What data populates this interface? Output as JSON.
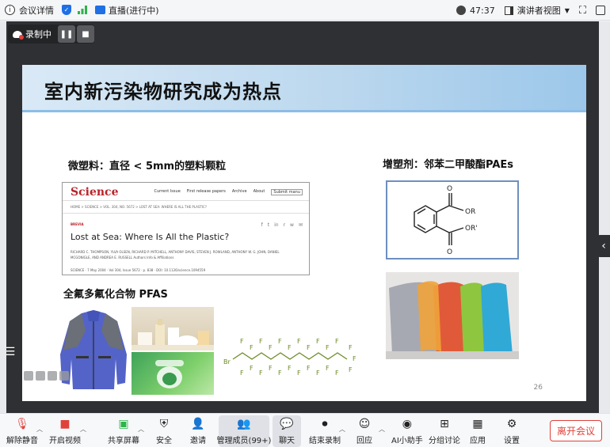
{
  "topbar": {
    "meeting_info": "会议详情",
    "live": "直播(进行中)",
    "timer": "47:37",
    "view_mode": "演讲者视图"
  },
  "recording": {
    "label": "录制中"
  },
  "slide": {
    "title": "室内新污染物研究成为热点",
    "microplastic_label": "微塑料：直径 < 5mm的塑料颗粒",
    "plasticizer_label": "增塑剂：邻苯二甲酸酯PAEs",
    "pfas_label": "全氟多氟化合物 PFAS",
    "page_number": "26",
    "science_card": {
      "logo": "Science",
      "nav": [
        "Current Issue",
        "First release papers",
        "Archive",
        "About",
        "Submit manu"
      ],
      "breadcrumb": "HOME > SCIENCE > VOL. 304, NO. 5672 > LOST AT SEA: WHERE IS ALL THE PLASTIC?",
      "category": "BREVIA",
      "headline": "Lost at Sea: Where Is All the Plastic?",
      "authors": "RICHARD C. THOMPSON, YLVA OLSEN, RICHARD P. MITCHELL, ANTHONY DAVIS, STEVEN J. ROWLAND, ANTHONY W. G. JOHN, DANIEL MCGONIGLE, AND ANDREA E. RUSSELL  Authors Info & Affiliations",
      "footer": "SCIENCE · 7 May 2004 · Vol 304, Issue 5672 · p. 838 · DOI: 10.1126/science.1094559"
    },
    "chem_labels": {
      "or1": "OR",
      "or2": "OR'",
      "o_top": "O",
      "o_bottom": "O"
    },
    "pfas_labels": {
      "br": "Br",
      "f": "F"
    }
  },
  "toolbar": {
    "unmute": "解除静音",
    "start_video": "开启视频",
    "share_screen": "共享屏幕",
    "security": "安全",
    "invite": "邀请",
    "manage_members": "管理成员(99+)",
    "chat": "聊天",
    "end_recording": "结束录制",
    "react": "回应",
    "ai_assistant": "AI小助手",
    "breakout": "分组讨论",
    "apps": "应用",
    "settings": "设置",
    "leave": "离开会议"
  },
  "colors": {
    "leave_red": "#e0413a",
    "science_red": "#b8232a",
    "pfas_green": "#6a8a22",
    "title_band": "#bcd8ee"
  }
}
